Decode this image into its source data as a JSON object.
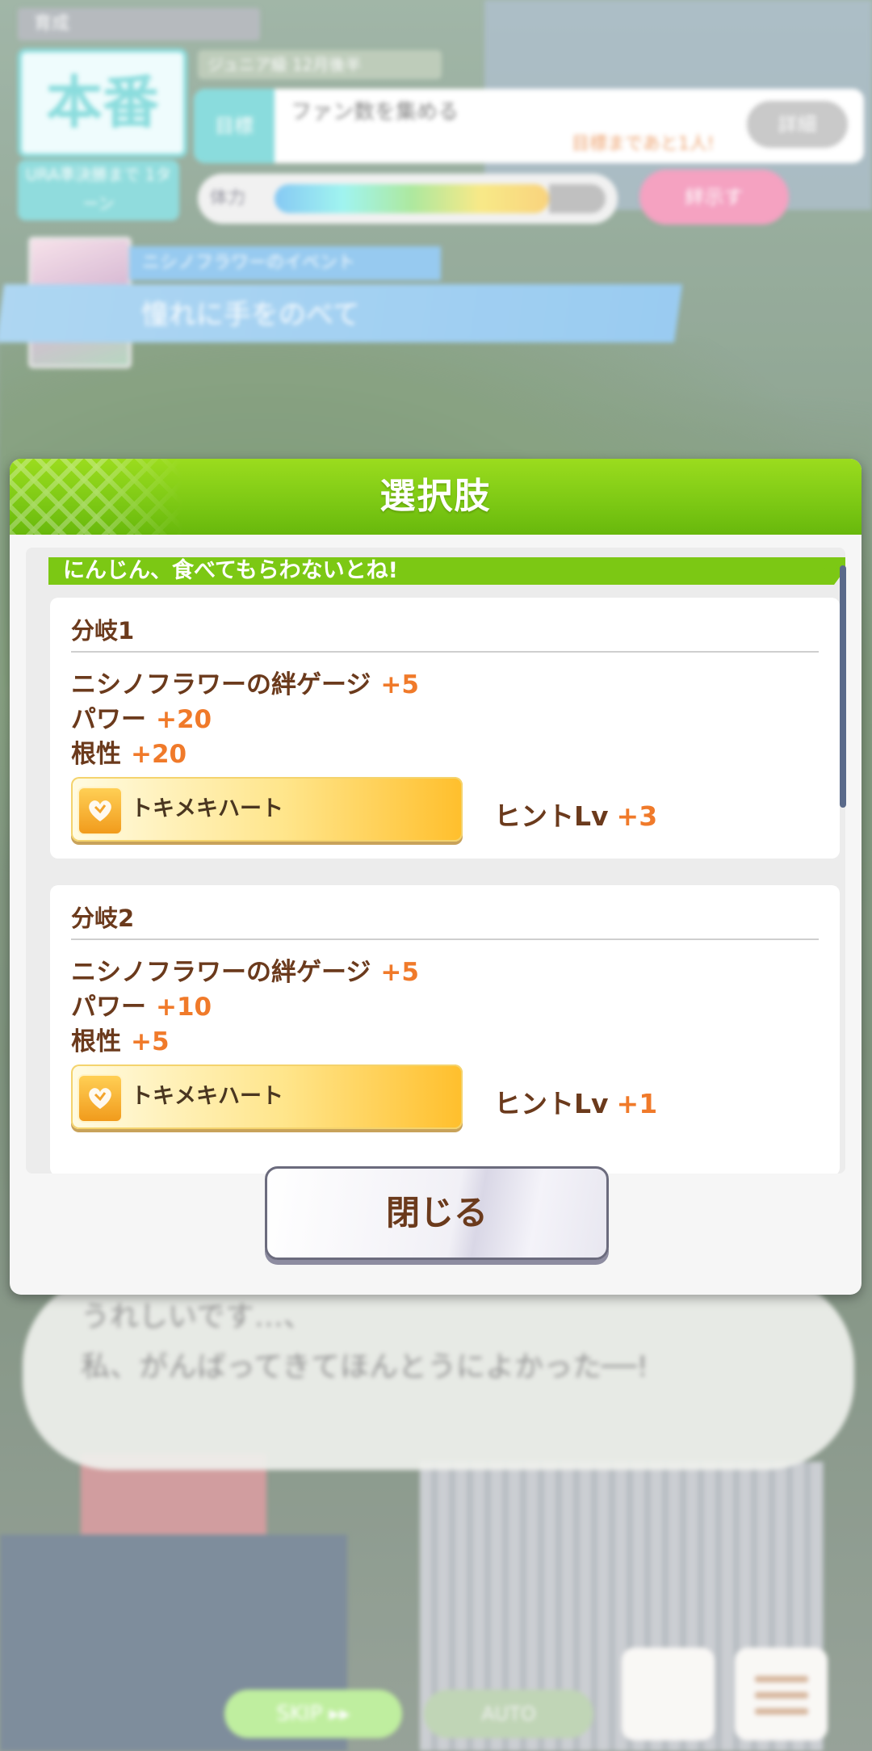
{
  "background": {
    "turn_label": "育成",
    "turn_big": "本番",
    "turn_sub": "URA準決勝まで 1ターン",
    "goal_strip": "ジュニア級 12月後半",
    "goal_tab": "目標",
    "goal_text": "ファン数を集める",
    "goal_red": "目標まであと1人!",
    "goal_button": "詳細",
    "mood_label": "体力",
    "pink_button": "絆示す",
    "event_subtitle": "ニシノフラワーのイベント",
    "event_title": "憧れに手をのべて",
    "dialog_line1": "うれしいです…、",
    "dialog_line2": "私、がんばってきてほんとうによかった──!",
    "skip_label": "SKIP ▸▸",
    "auto_label": "AUTO"
  },
  "modal": {
    "title": "選択肢",
    "choice_text": "にんじん、食べてもらわないとね!",
    "branches": [
      {
        "title": "分岐1",
        "stats": [
          {
            "label": "ニシノフラワーの絆ゲージ",
            "value": "+5"
          },
          {
            "label": "パワー",
            "value": "+20"
          },
          {
            "label": "根性",
            "value": "+20"
          }
        ],
        "skill": "トキメキハート",
        "hint_label": "ヒントLv",
        "hint_value": "+3"
      },
      {
        "title": "分岐2",
        "stats": [
          {
            "label": "ニシノフラワーの絆ゲージ",
            "value": "+5"
          },
          {
            "label": "パワー",
            "value": "+10"
          },
          {
            "label": "根性",
            "value": "+5"
          }
        ],
        "skill": "トキメキハート",
        "hint_label": "ヒントLv",
        "hint_value": "+1"
      }
    ],
    "close_label": "閉じる"
  }
}
